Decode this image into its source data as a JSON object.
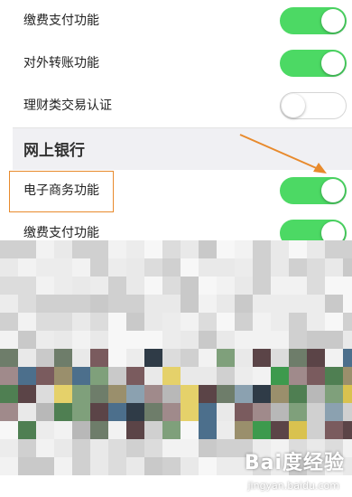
{
  "rows": [
    {
      "label": "缴费支付功能",
      "on": true
    },
    {
      "label": "对外转账功能",
      "on": true
    },
    {
      "label": "理财类交易认证",
      "on": false
    }
  ],
  "section": {
    "title": "网上银行",
    "rows": [
      {
        "label": "电子商务功能",
        "on": true
      },
      {
        "label": "缴费支付功能",
        "on": true
      }
    ]
  },
  "colors": {
    "switch_on": "#4cd964",
    "highlight": "#e88a2c",
    "arrow": "#e88a2c"
  },
  "watermark": {
    "text": "Bai度经验",
    "sub": "jingyan.baidu.com"
  }
}
